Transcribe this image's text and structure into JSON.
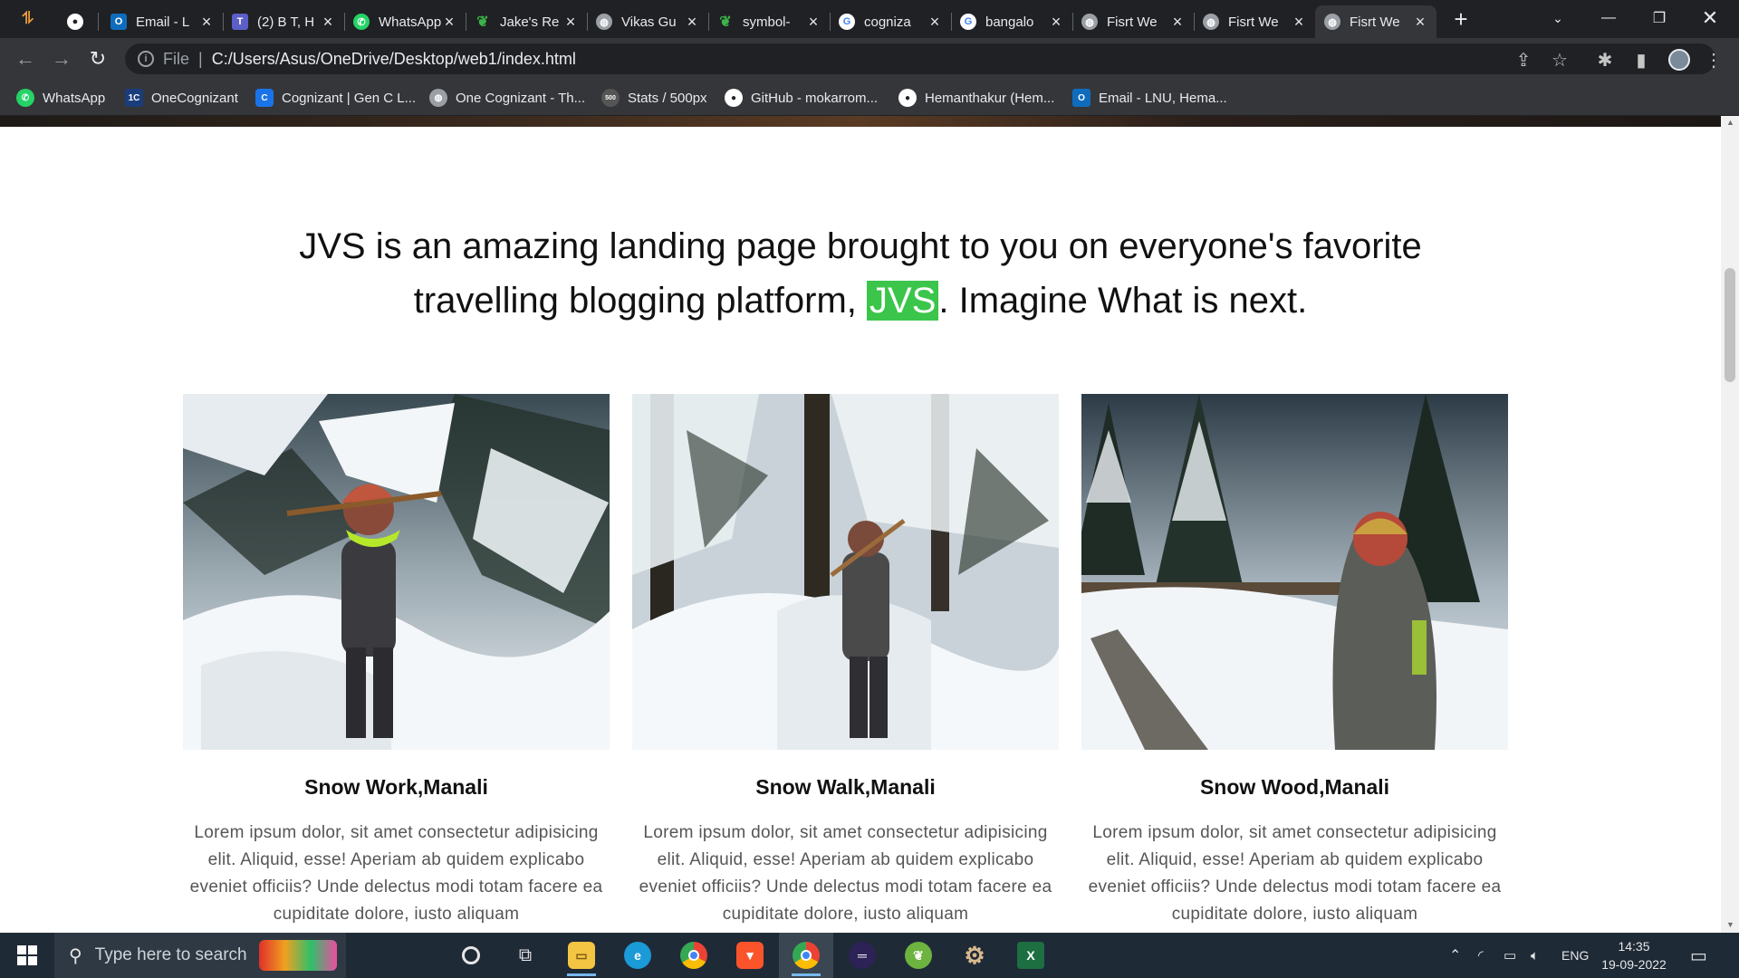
{
  "browser": {
    "tabs": [
      {
        "label": "",
        "icon": "github-icon",
        "color": "#ffffff"
      },
      {
        "label": "Email - L",
        "icon": "outlook-icon",
        "color": "#0f6cbd"
      },
      {
        "label": "(2) B T, H",
        "icon": "teams-icon",
        "color": "#5b5fc7"
      },
      {
        "label": "WhatsApp",
        "icon": "whatsapp-icon",
        "color": "#25d366"
      },
      {
        "label": "Jake's Re",
        "icon": "leaf-icon",
        "color": "#3bb54a"
      },
      {
        "label": "Vikas Gu",
        "icon": "globe-icon",
        "color": "#9aa0a6"
      },
      {
        "label": "symbol-",
        "icon": "leaf-icon",
        "color": "#3bb54a"
      },
      {
        "label": "cogniza",
        "icon": "google-icon",
        "color": "#4285f4"
      },
      {
        "label": "bangalo",
        "icon": "google-icon",
        "color": "#4285f4"
      },
      {
        "label": "Fisrt We",
        "icon": "globe-icon",
        "color": "#9aa0a6"
      },
      {
        "label": "Fisrt We",
        "icon": "globe-icon",
        "color": "#9aa0a6"
      },
      {
        "label": "Fisrt We",
        "icon": "globe-icon",
        "color": "#9aa0a6"
      }
    ],
    "address": {
      "scheme": "File",
      "url": "C:/Users/Asus/OneDrive/Desktop/web1/index.html"
    },
    "bookmarks": [
      {
        "label": "WhatsApp",
        "icon": "whatsapp-icon",
        "color": "#25d366"
      },
      {
        "label": "OneCognizant",
        "icon": "onecognizant-icon",
        "color": "#1a3d7c"
      },
      {
        "label": "Cognizant | Gen C L...",
        "icon": "cognizant-icon",
        "color": "#1a73e8"
      },
      {
        "label": "One Cognizant - Th...",
        "icon": "globe-icon",
        "color": "#9aa0a6"
      },
      {
        "label": "Stats / 500px",
        "icon": "500px-icon",
        "color": "#555555"
      },
      {
        "label": "GitHub - mokarrom...",
        "icon": "github-icon",
        "color": "#ffffff"
      },
      {
        "label": "Hemanthakur (Hem...",
        "icon": "github-icon",
        "color": "#ffffff"
      },
      {
        "label": "Email - LNU, Hema...",
        "icon": "outlook-icon",
        "color": "#0f6cbd"
      }
    ]
  },
  "page": {
    "intro_before": "JVS is an amazing landing page brought to you on everyone's favorite travelling blogging platform, ",
    "intro_highlight": "JVS",
    "intro_after": ". Imagine What is next.",
    "highlight_color": "#3bc54a",
    "cards": [
      {
        "title": "Snow Work,Manali",
        "desc": "Lorem ipsum dolor, sit amet consectetur adipisicing elit. Aliquid, esse! Aperiam ab quidem explicabo eveniet officiis? Unde delectus modi totam facere ea cupiditate dolore, iusto aliquam"
      },
      {
        "title": "Snow Walk,Manali",
        "desc": "Lorem ipsum dolor, sit amet consectetur adipisicing elit. Aliquid, esse! Aperiam ab quidem explicabo eveniet officiis? Unde delectus modi totam facere ea cupiditate dolore, iusto aliquam"
      },
      {
        "title": "Snow Wood,Manali",
        "desc": "Lorem ipsum dolor, sit amet consectetur adipisicing elit. Aliquid, esse! Aperiam ab quidem explicabo eveniet officiis? Unde delectus modi totam facere ea cupiditate dolore, iusto aliquam"
      }
    ]
  },
  "taskbar": {
    "search_placeholder": "Type here to search",
    "language": "ENG",
    "time": "14:35",
    "date": "19-09-2022"
  }
}
